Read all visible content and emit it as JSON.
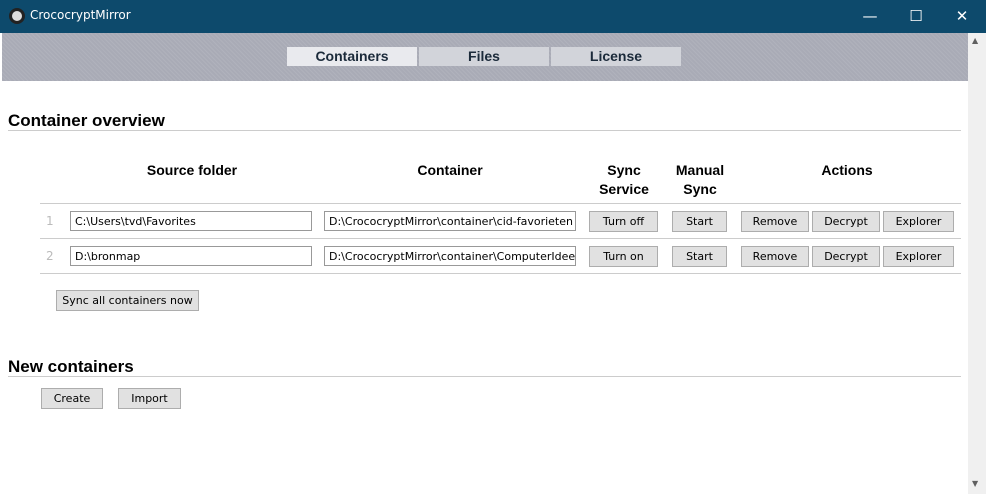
{
  "window": {
    "title": "CrococryptMirror",
    "minimize": "—",
    "maximize": "☐",
    "close": "✕"
  },
  "tabs": [
    "Containers",
    "Files",
    "License"
  ],
  "overview": {
    "heading": "Container overview",
    "headers": {
      "source": "Source folder",
      "container": "Container",
      "sync1": "Sync",
      "sync2": "Service",
      "manual1": "Manual",
      "manual2": "Sync",
      "actions": "Actions"
    },
    "rows": [
      {
        "num": "1",
        "source": "C:\\Users\\tvd\\Favorites",
        "container": "D:\\CrococryptMirror\\container\\cid-favorieten",
        "sync": "Turn off",
        "manual": "Start",
        "remove": "Remove",
        "decrypt": "Decrypt",
        "explorer": "Explorer"
      },
      {
        "num": "2",
        "source": "D:\\bronmap",
        "container": "D:\\CrococryptMirror\\container\\ComputerIdee-artikelen",
        "sync": "Turn on",
        "manual": "Start",
        "remove": "Remove",
        "decrypt": "Decrypt",
        "explorer": "Explorer"
      }
    ],
    "sync_all": "Sync all containers now"
  },
  "new": {
    "heading": "New containers",
    "create": "Create",
    "import": "Import"
  },
  "scroll": {
    "up": "▲",
    "down": "▼"
  }
}
